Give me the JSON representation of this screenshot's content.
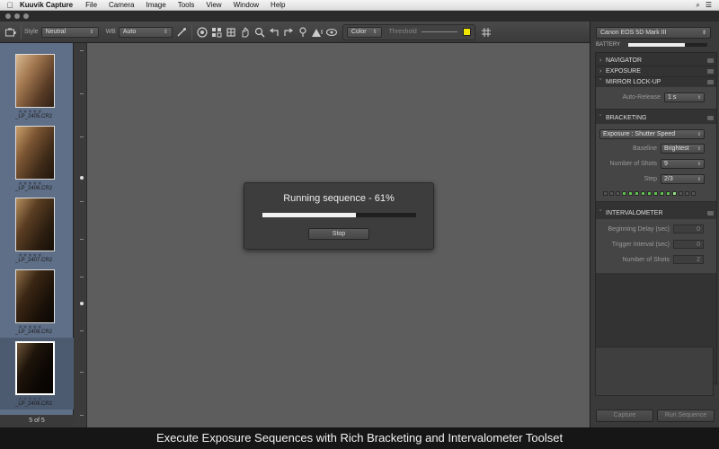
{
  "menubar": {
    "apple": "",
    "app_name": "Kuuvik Capture",
    "items": [
      "File",
      "Camera",
      "Image",
      "Tools",
      "View",
      "Window",
      "Help"
    ],
    "right_icons": [
      "⌕",
      "☰"
    ]
  },
  "toolbar": {
    "style_label": "Style",
    "style_value": "Neutral",
    "wb_label": "WB",
    "wb_value": "Auto",
    "color_value": "Color",
    "threshold_label": "Threshold",
    "threshold_color": "#f2e600",
    "icons": [
      "camera-icon",
      "eyedropper-icon",
      "aperture-icon",
      "grid-view-icon",
      "crop-icon",
      "hand-icon",
      "zoom-icon",
      "rotate-left-icon",
      "rotate-right-icon",
      "pin-icon",
      "exposure-warning-icon",
      "eye-icon",
      "grid-overlay-icon"
    ]
  },
  "filmstrip": {
    "thumbs": [
      {
        "name": "_LP_2405.CR2",
        "stars": "★★★★★"
      },
      {
        "name": "_LP_2406.CR2",
        "stars": "★★★★★"
      },
      {
        "name": "_LP_2407.CR2",
        "stars": "★★★★★"
      },
      {
        "name": "_LP_2408.CR2",
        "stars": "★★★★★"
      },
      {
        "name": "_LP_2409.CR2",
        "stars": "★★★★★"
      }
    ],
    "count": "5 of 5"
  },
  "progress": {
    "title": "Running sequence - 61%",
    "percent": 61,
    "stop_label": "Stop"
  },
  "panel": {
    "camera": "Canon EOS 5D Mark III",
    "battery_label": "BATTERY",
    "battery_level": 0.72,
    "sections": {
      "navigator": "NAVIGATOR",
      "exposure": "EXPOSURE",
      "mirror": "MIRROR LOCK-UP",
      "bracketing": "BRACKETING",
      "intervalometer": "INTERVALOMETER"
    },
    "auto_release_label": "Auto-Release",
    "auto_release_value": "1 s",
    "bracket_type": "Exposure : Shutter Speed",
    "baseline_label": "Baseline",
    "baseline_value": "Brightest",
    "shots_label": "Number of Shots",
    "shots_value": "9",
    "step_label": "Step",
    "step_value": "2/3",
    "beginning_delay_label": "Beginning Delay (sec)",
    "beginning_delay_value": "0",
    "trigger_interval_label": "Trigger Interval (sec)",
    "trigger_interval_value": "0",
    "interval_shots_label": "Number of Shots",
    "interval_shots_value": "2",
    "capture_label": "Capture",
    "run_label": "Run Sequence"
  },
  "caption": "Execute Exposure Sequences with Rich Bracketing and Intervalometer Toolset"
}
